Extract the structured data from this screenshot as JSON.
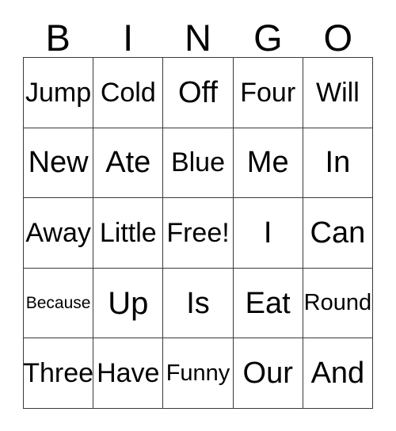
{
  "card": {
    "headers": [
      "B",
      "I",
      "N",
      "G",
      "O"
    ],
    "rows": [
      [
        {
          "text": "Jump",
          "size": "md"
        },
        {
          "text": "Cold",
          "size": "md"
        },
        {
          "text": "Off",
          "size": "lg"
        },
        {
          "text": "Four",
          "size": "md"
        },
        {
          "text": "Will",
          "size": "md"
        }
      ],
      [
        {
          "text": "New",
          "size": "lg"
        },
        {
          "text": "Ate",
          "size": "lg"
        },
        {
          "text": "Blue",
          "size": "md"
        },
        {
          "text": "Me",
          "size": "lg"
        },
        {
          "text": "In",
          "size": "lg"
        }
      ],
      [
        {
          "text": "Away",
          "size": "md"
        },
        {
          "text": "Little",
          "size": "md"
        },
        {
          "text": "Free!",
          "size": "md"
        },
        {
          "text": "I",
          "size": "lg"
        },
        {
          "text": "Can",
          "size": "lg"
        }
      ],
      [
        {
          "text": "Because",
          "size": "xs"
        },
        {
          "text": "Up",
          "size": "xl"
        },
        {
          "text": "Is",
          "size": "lg"
        },
        {
          "text": "Eat",
          "size": "lg"
        },
        {
          "text": "Round",
          "size": "sm"
        }
      ],
      [
        {
          "text": "Three",
          "size": "md"
        },
        {
          "text": "Have",
          "size": "md"
        },
        {
          "text": "Funny",
          "size": "sm"
        },
        {
          "text": "Our",
          "size": "lg"
        },
        {
          "text": "And",
          "size": "lg"
        }
      ]
    ],
    "colors": {
      "text": "#000000",
      "grid_line": "#3a3a3a",
      "background": "#ffffff"
    }
  }
}
